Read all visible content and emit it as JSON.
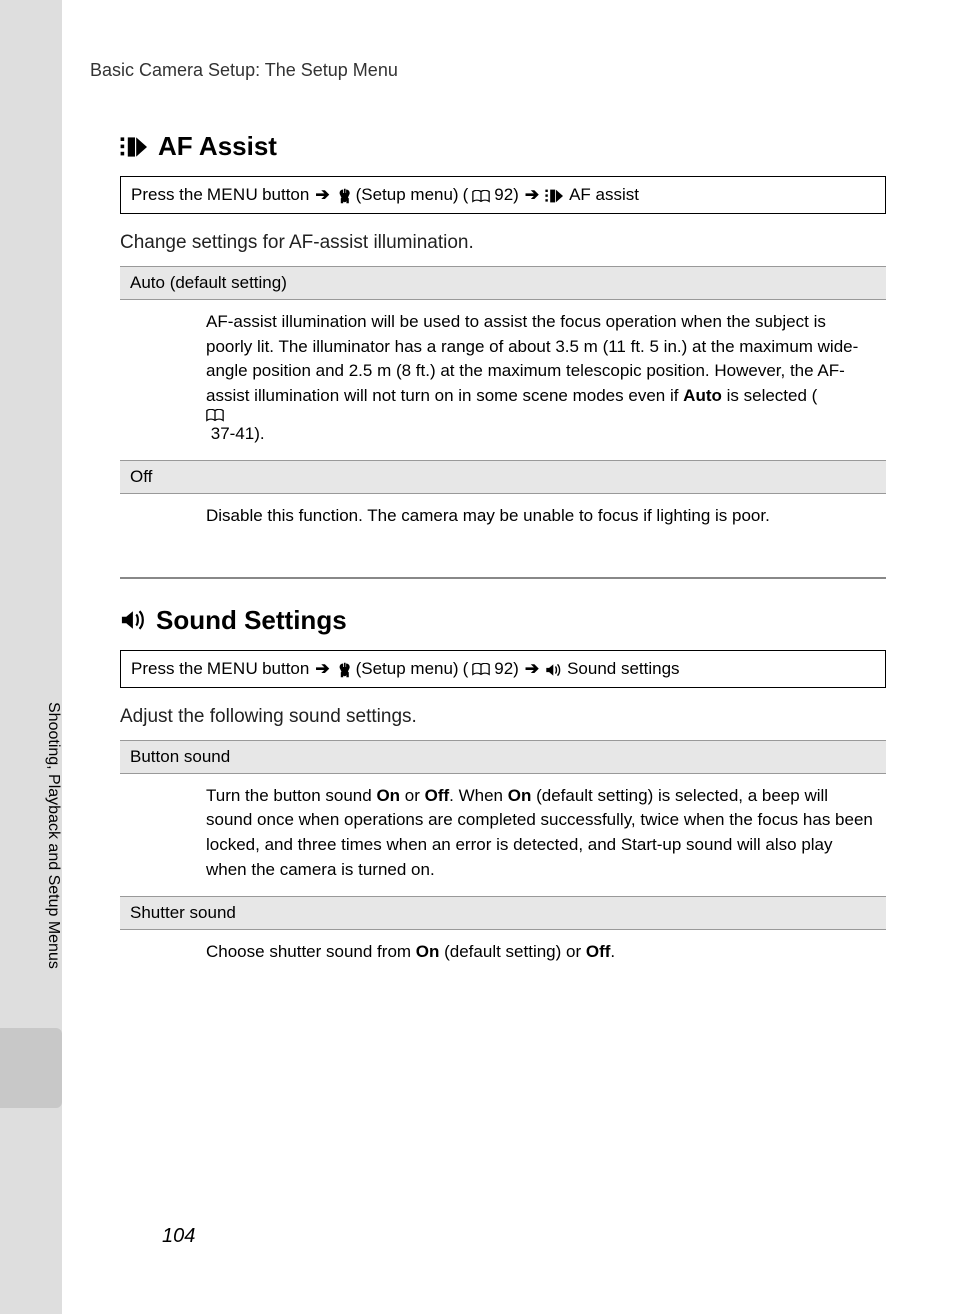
{
  "running_head": "Basic Camera Setup: The Setup Menu",
  "side_tab": "Shooting, Playback and Setup Menus",
  "page_number": "104",
  "nav": {
    "press_the": "Press the",
    "menu_word": "MENU",
    "button_word": "button",
    "setup_menu": "(Setup menu)",
    "page_ref_92": "92)"
  },
  "sections": [
    {
      "icon": "af-assist-icon",
      "title": "AF Assist",
      "crumb_tail": "AF assist",
      "intro": "Change settings for AF-assist illumination.",
      "options": [
        {
          "name": "Auto (default setting)",
          "desc_pre": "AF-assist illumination will be used to assist the focus operation when the subject is poorly lit. The illuminator has a range of about 3.5 m (11 ft. 5 in.) at the maximum wide-angle position and 2.5 m (8 ft.) at the maximum telescopic position. However, the AF-assist illumination will not turn on in some scene modes even if ",
          "desc_bold": "Auto",
          "desc_post": " is selected (",
          "desc_ref": "37-41).",
          "has_ref": true
        },
        {
          "name": "Off",
          "desc_pre": "Disable this function. The camera may be unable to focus if lighting is poor.",
          "desc_bold": "",
          "desc_post": "",
          "desc_ref": "",
          "has_ref": false
        }
      ]
    },
    {
      "icon": "sound-icon",
      "title": "Sound Settings",
      "crumb_tail": "Sound settings",
      "intro": "Adjust the following sound settings.",
      "options": [
        {
          "name": "Button sound",
          "segments": [
            {
              "t": "Turn the button sound ",
              "b": false
            },
            {
              "t": "On",
              "b": true
            },
            {
              "t": " or ",
              "b": false
            },
            {
              "t": "Off",
              "b": true
            },
            {
              "t": ". When ",
              "b": false
            },
            {
              "t": "On",
              "b": true
            },
            {
              "t": " (default setting) is selected, a beep will sound once when operations are completed successfully, twice when the focus has been locked, and three times when an error is detected, and Start-up sound will also play when the camera is turned on.",
              "b": false
            }
          ]
        },
        {
          "name": "Shutter sound",
          "segments": [
            {
              "t": "Choose shutter sound from ",
              "b": false
            },
            {
              "t": "On",
              "b": true
            },
            {
              "t": " (default setting) or ",
              "b": false
            },
            {
              "t": "Off",
              "b": true
            },
            {
              "t": ".",
              "b": false
            }
          ]
        }
      ]
    }
  ]
}
